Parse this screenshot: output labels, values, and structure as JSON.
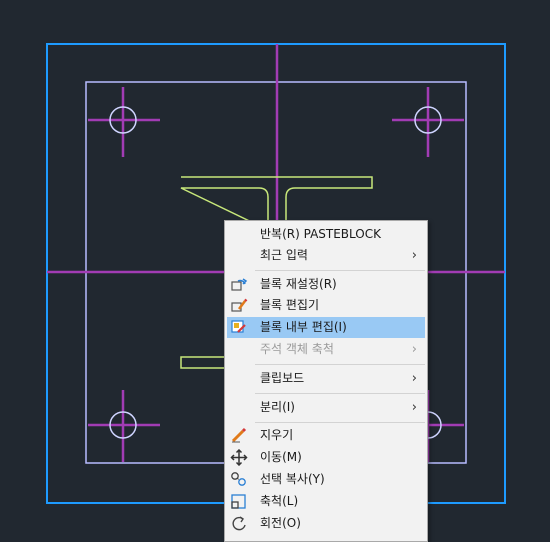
{
  "context_menu": {
    "items": [
      {
        "label": "반복(R) PASTEBLOCK",
        "icon": "none"
      },
      {
        "label": "최근 입력",
        "icon": "none",
        "submenu": "›"
      },
      {
        "label": "블록 재설정(R)",
        "icon": "block-reset-icon"
      },
      {
        "label": "블록 편집기",
        "icon": "block-editor-icon"
      },
      {
        "label": "블록 내부 편집(I)",
        "icon": "block-inplace-edit-icon",
        "highlighted": true
      },
      {
        "label": "주석 객체 축척",
        "icon": "none",
        "submenu": "›",
        "disabled": true
      },
      {
        "label": "클립보드",
        "icon": "none",
        "submenu": "›"
      },
      {
        "label": "분리(I)",
        "icon": "none",
        "submenu": "›"
      },
      {
        "label": "지우기",
        "icon": "eraser-icon"
      },
      {
        "label": "이동(M)",
        "icon": "move-icon"
      },
      {
        "label": "선택 복사(Y)",
        "icon": "copy-selection-icon"
      },
      {
        "label": "축척(L)",
        "icon": "scale-icon"
      },
      {
        "label": "회전(O)",
        "icon": "rotate-icon"
      }
    ]
  },
  "colors": {
    "background": "#212830",
    "outer_frame": "#1e9bff",
    "inner_frame": "#b8bcff",
    "centerlines": "#a23cb4",
    "beam": "#c8e87a",
    "menu_highlight": "#99c9f4"
  }
}
